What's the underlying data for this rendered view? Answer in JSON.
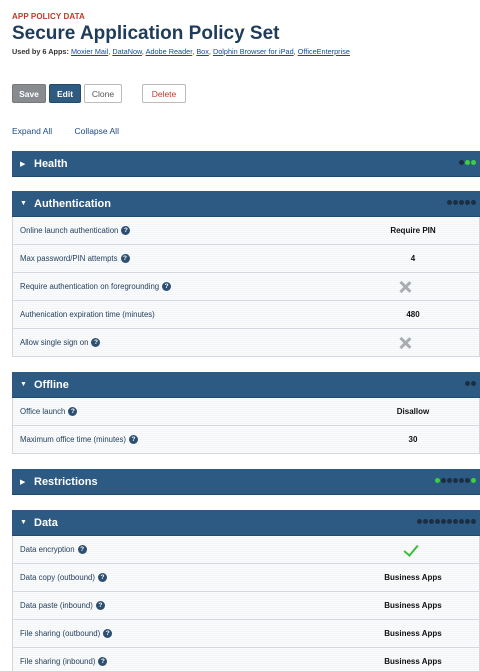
{
  "header": {
    "eyebrow": "APP POLICY DATA",
    "title": "Secure Application Policy Set",
    "used_by_label": "Used by 6 Apps:",
    "apps": [
      "Moxier Mail",
      "DataNow",
      "Adobe Reader",
      "Box",
      "Dolphin Browser for iPad",
      "OfficeEnterprise"
    ]
  },
  "toolbar": {
    "save": "Save",
    "edit": "Edit",
    "clone": "Clone",
    "delete": "Delete"
  },
  "expand": {
    "expand_all": "Expand All",
    "collapse_all": "Collapse All"
  },
  "sections": {
    "health": {
      "title": "Health",
      "state": "collapsed",
      "dots": [
        "dark",
        "green",
        "green"
      ]
    },
    "authentication": {
      "title": "Authentication",
      "state": "expanded",
      "dots": [
        "dark",
        "dark",
        "dark",
        "dark",
        "dark"
      ],
      "rows": [
        {
          "label": "Online launch authentication",
          "value": "Require PIN"
        },
        {
          "label": "Max password/PIN attempts",
          "value": "4"
        },
        {
          "label": "Require authentication on foregrounding",
          "value": "x-icon"
        },
        {
          "label": "Authenication expiration time (minutes)",
          "value": "480"
        },
        {
          "label": "Allow single sign on",
          "value": "x-icon"
        }
      ]
    },
    "offline": {
      "title": "Offline",
      "state": "expanded",
      "dots": [
        "dark",
        "dark"
      ],
      "rows": [
        {
          "label": "Office launch",
          "value": "Disallow"
        },
        {
          "label": "Maximum office time (minutes)",
          "value": "30"
        }
      ]
    },
    "restrictions": {
      "title": "Restrictions",
      "state": "collapsed",
      "dots": [
        "green",
        "dark",
        "dark",
        "dark",
        "dark",
        "dark",
        "green"
      ]
    },
    "data": {
      "title": "Data",
      "state": "expanded",
      "dots": [
        "dark",
        "dark",
        "dark",
        "dark",
        "dark",
        "dark",
        "dark",
        "dark",
        "dark",
        "dark"
      ],
      "rows": [
        {
          "label": "Data encryption",
          "value": "check-icon"
        },
        {
          "label": "Data copy (outbound)",
          "value": "Business Apps"
        },
        {
          "label": "Data paste (inbound)",
          "value": "Business Apps"
        },
        {
          "label": "File sharing (outbound)",
          "value": "Business Apps"
        },
        {
          "label": "File sharing (inbound)",
          "value": "Business Apps"
        }
      ]
    }
  },
  "colors": {
    "accent": "#2d5a82",
    "eyebrow": "#c0392b",
    "success": "#3dbf3d",
    "dot_green": "#3dcf3d"
  }
}
